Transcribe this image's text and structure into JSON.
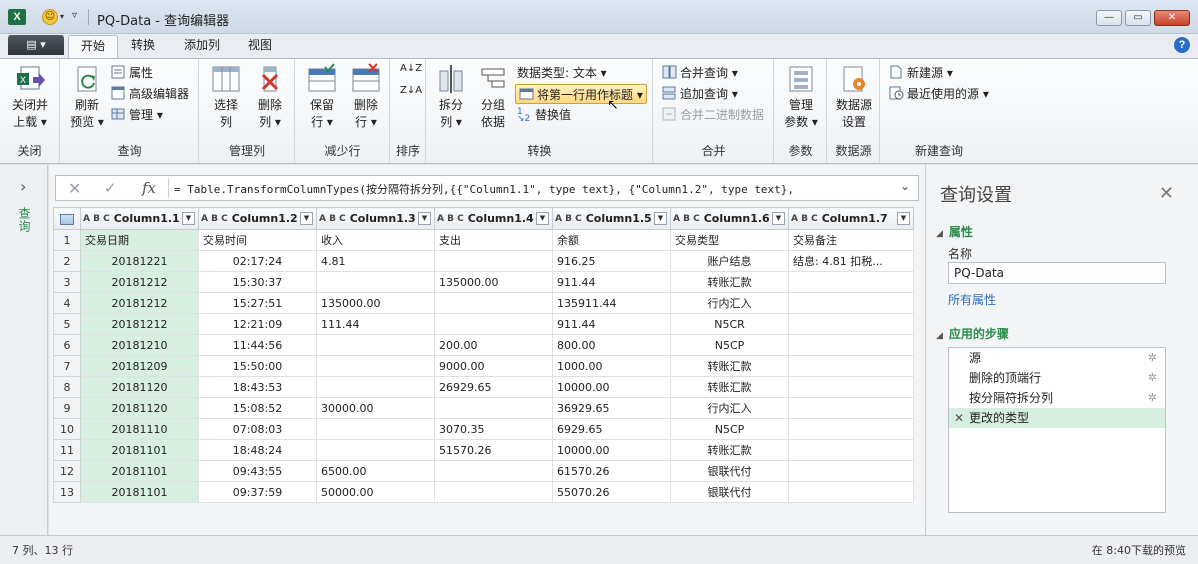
{
  "window": {
    "title": "PQ-Data - 查询编辑器",
    "app_icon": "X",
    "minimize_icon": "—",
    "maximize_icon": "▭",
    "close_icon": "✕"
  },
  "tabs": {
    "file_icon": "▤ ▾",
    "items": [
      "开始",
      "转换",
      "添加列",
      "视图"
    ],
    "help_icon": "?"
  },
  "ribbon": {
    "groups": {
      "close": {
        "label": "关闭",
        "close_load_line1": "关闭并",
        "close_load_line2": "上载 ▾"
      },
      "query": {
        "label": "查询",
        "refresh_line1": "刷新",
        "refresh_line2": "预览 ▾",
        "properties": "属性",
        "advanced_editor": "高级编辑器",
        "manage": "管理 ▾"
      },
      "manage_columns": {
        "label": "管理列",
        "choose_line1": "选择",
        "choose_line2": "列",
        "remove_line1": "删除",
        "remove_line2": "列 ▾"
      },
      "reduce_rows": {
        "label": "减少行",
        "keep_line1": "保留",
        "keep_line2": "行 ▾",
        "remove_line1": "删除",
        "remove_line2": "行 ▾"
      },
      "sort": {
        "label": "排序",
        "asc": "A↓Z",
        "desc": "Z↓A"
      },
      "transform": {
        "label": "转换",
        "split_line1": "拆分",
        "split_line2": "列 ▾",
        "group_line1": "分组",
        "group_line2": "依据",
        "data_type": "数据类型: 文本 ▾",
        "first_row_headers": "将第一行用作标题 ▾",
        "replace_values": "替换值"
      },
      "combine": {
        "label": "合并",
        "merge": "合并查询 ▾",
        "append": "追加查询 ▾",
        "combine_binaries": "合并二进制数据"
      },
      "parameters": {
        "label": "参数",
        "manage_line1": "管理",
        "manage_line2": "参数 ▾"
      },
      "datasource": {
        "label": "数据源",
        "settings_line1": "数据源",
        "settings_line2": "设置"
      },
      "new_query": {
        "label": "新建查询",
        "new_source": "新建源 ▾",
        "recent_sources": "最近使用的源 ▾"
      }
    }
  },
  "left_panel": {
    "expand_icon": "›",
    "label": "查询"
  },
  "formula_bar": {
    "cancel_icon": "✕",
    "commit_icon": "✓",
    "fx": "fx",
    "formula": "= Table.TransformColumnTypes(按分隔符拆分列,{{\"Column1.1\", type text}, {\"Column1.2\", type text},",
    "expand_icon": "⌄"
  },
  "grid": {
    "type_icon": "A B C",
    "columns": [
      "Column1.1",
      "Column1.2",
      "Column1.3",
      "Column1.4",
      "Column1.5",
      "Column1.6",
      "Column1.7"
    ],
    "rows": [
      [
        "1",
        "交易日期",
        "交易时间",
        "收入",
        "支出",
        "余额",
        "交易类型",
        "交易备注"
      ],
      [
        "2",
        "20181221",
        "02:17:24",
        "4.81",
        "",
        "916.25",
        "账户结息",
        "结息: 4.81 扣税..."
      ],
      [
        "3",
        "20181212",
        "15:30:37",
        "",
        "135000.00",
        "911.44",
        "转账汇款",
        ""
      ],
      [
        "4",
        "20181212",
        "15:27:51",
        "135000.00",
        "",
        "135911.44",
        "行内汇入",
        ""
      ],
      [
        "5",
        "20181212",
        "12:21:09",
        "111.44",
        "",
        "911.44",
        "N5CR",
        ""
      ],
      [
        "6",
        "20181210",
        "11:44:56",
        "",
        "200.00",
        "800.00",
        "N5CP",
        ""
      ],
      [
        "7",
        "20181209",
        "15:50:00",
        "",
        "9000.00",
        "1000.00",
        "转账汇款",
        ""
      ],
      [
        "8",
        "20181120",
        "18:43:53",
        "",
        "26929.65",
        "10000.00",
        "转账汇款",
        ""
      ],
      [
        "9",
        "20181120",
        "15:08:52",
        "30000.00",
        "",
        "36929.65",
        "行内汇入",
        ""
      ],
      [
        "10",
        "20181110",
        "07:08:03",
        "",
        "3070.35",
        "6929.65",
        "N5CP",
        ""
      ],
      [
        "11",
        "20181101",
        "18:48:24",
        "",
        "51570.26",
        "10000.00",
        "转账汇款",
        ""
      ],
      [
        "12",
        "20181101",
        "09:43:55",
        "6500.00",
        "",
        "61570.26",
        "银联代付",
        ""
      ],
      [
        "13",
        "20181101",
        "09:37:59",
        "50000.00",
        "",
        "55070.26",
        "银联代付",
        ""
      ]
    ]
  },
  "query_settings": {
    "title": "查询设置",
    "close_icon": "✕",
    "properties_header": "属性",
    "name_label": "名称",
    "name_value": "PQ-Data",
    "all_properties": "所有属性",
    "steps_header": "应用的步骤",
    "steps": [
      "源",
      "删除的顶端行",
      "按分隔符拆分列",
      "更改的类型"
    ]
  },
  "status": {
    "left": "7 列、13 行",
    "right": "在 8:40下载的预览"
  },
  "colors": {
    "accent_green": "#2a8a4a",
    "selected_column": "#d7efe0",
    "excel_green": "#1e7145"
  }
}
